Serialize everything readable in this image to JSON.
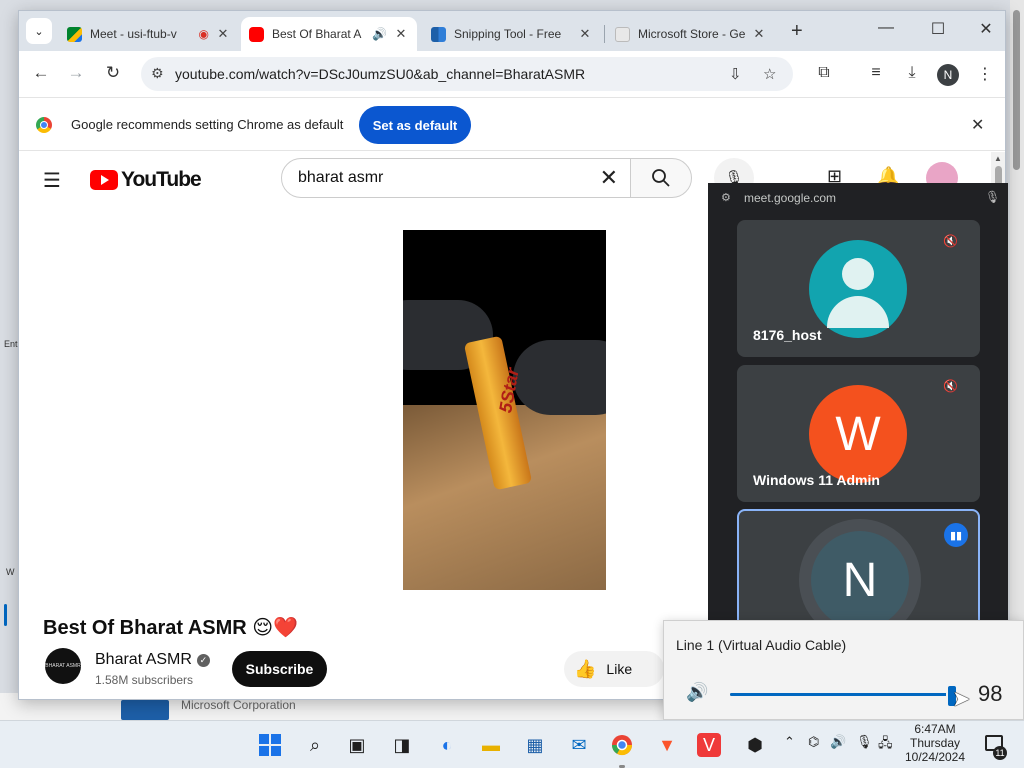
{
  "desktop": {
    "edge_texts": [
      "Ent",
      "W"
    ],
    "ms_store_text": "Microsoft Corporation"
  },
  "browser": {
    "tabs": [
      {
        "title": "Meet - usi-ftub-v",
        "favicon": "google-meet-icon",
        "extra": "recording-icon"
      },
      {
        "title": "Best Of Bharat A",
        "favicon": "youtube-icon",
        "extra": "audio-playing-icon",
        "active": true
      },
      {
        "title": "Snipping Tool - Free",
        "favicon": "microsoft-store-icon"
      },
      {
        "title": "Microsoft Store - Ge",
        "favicon": "microsoft-store-icon"
      }
    ],
    "url": "youtube.com/watch?v=DScJ0umzSU0&ab_channel=BharatASMR",
    "profile_initial": "N",
    "infobar": {
      "message": "Google recommends setting Chrome as default",
      "button": "Set as default"
    }
  },
  "youtube": {
    "logo_text": "YouTube",
    "search_query": "bharat asmr",
    "video": {
      "title": "Best Of Bharat ASMR",
      "title_emojis": "😌❤️",
      "product_label": "5Star"
    },
    "channel": {
      "name": "Bharat ASMR",
      "subscribers": "1.58M subscribers",
      "avatar_text": "BHARAT ASMR"
    },
    "subscribe_label": "Subscribe",
    "like_label": "Like"
  },
  "meet_pip": {
    "url": "meet.google.com",
    "participants": [
      {
        "name": "8176_host",
        "avatar": "person-icon",
        "color": "#12a4af",
        "muted": true
      },
      {
        "name": "Windows 11 Admin",
        "initial": "W",
        "color": "#f4511e",
        "muted": true
      },
      {
        "initial": "N",
        "color": "#3f5b66",
        "speaking": true
      }
    ]
  },
  "volume_flyout": {
    "device": "Line 1 (Virtual Audio Cable)",
    "level": 98
  },
  "taskbar": {
    "time": "6:47AM",
    "day": "Thursday",
    "date": "10/24/2024",
    "notification_count": "11"
  }
}
